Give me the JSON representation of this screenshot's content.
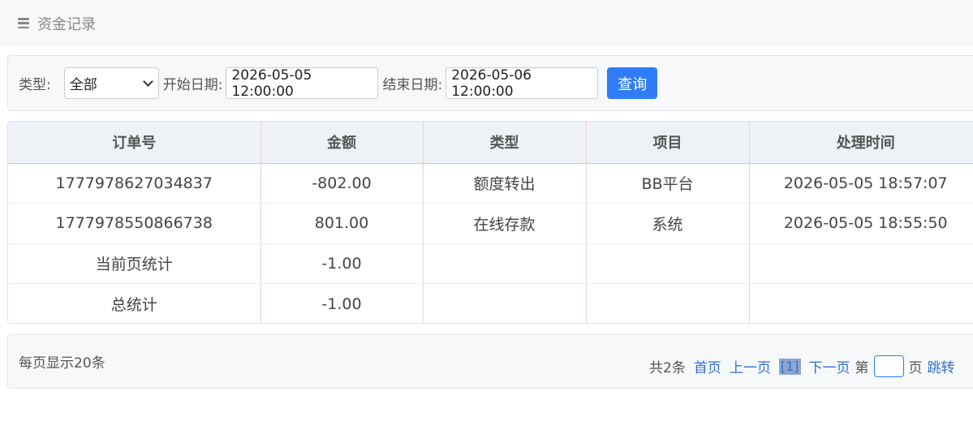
{
  "header": {
    "title": "资金记录",
    "icon": "menu-icon"
  },
  "filter": {
    "type_label": "类型:",
    "type_value": "全部",
    "start_label": "开始日期:",
    "start_value": "2026-05-05 12:00:00",
    "end_label": "结束日期:",
    "end_value": "2026-05-06 12:00:00",
    "query_label": "查询"
  },
  "table": {
    "columns": [
      "订单号",
      "金额",
      "类型",
      "项目",
      "处理时间"
    ],
    "rows": [
      [
        "1777978627034837",
        "-802.00",
        "额度转出",
        "BB平台",
        "2026-05-05 18:57:07"
      ],
      [
        "1777978550866738",
        "801.00",
        "在线存款",
        "系统",
        "2026-05-05 18:55:50"
      ],
      [
        "当前页统计",
        "-1.00",
        "",
        "",
        ""
      ],
      [
        "总统计",
        "-1.00",
        "",
        "",
        ""
      ]
    ]
  },
  "pager": {
    "per_page": "每页显示20条",
    "total": "共2条",
    "first": "首页",
    "prev": "上一页",
    "current": "[1]",
    "next": "下一页",
    "page_prefix": "第",
    "page_suffix": "页",
    "jump": "跳转"
  },
  "colors": {
    "primary": "#2f7cf6",
    "link": "#2f6fd6"
  }
}
